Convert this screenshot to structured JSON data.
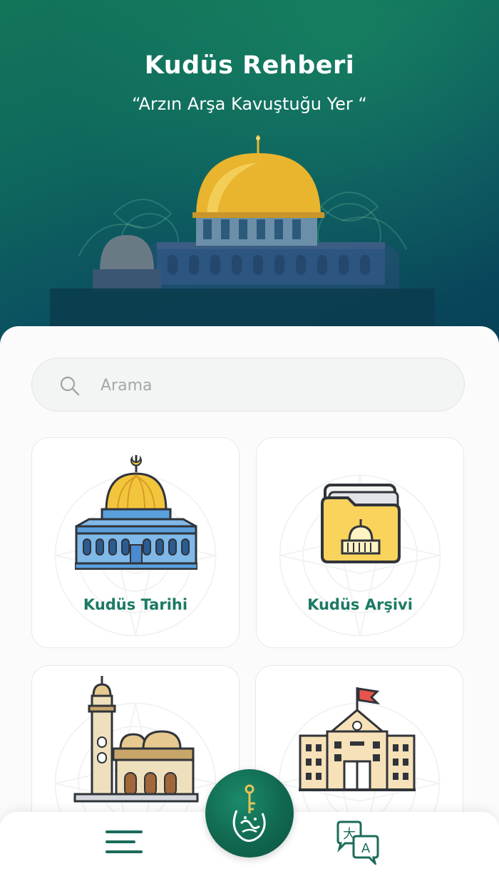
{
  "header": {
    "title": "Kudüs Rehberi",
    "subtitle": "“Arzın Arşa Kavuştuğu Yer “",
    "illustration": "dome-of-the-rock-photo"
  },
  "search": {
    "placeholder": "Arama",
    "value": "",
    "icon": "search-icon"
  },
  "tiles": [
    {
      "label": "Kudüs Tarihi",
      "icon": "dome-of-the-rock-icon"
    },
    {
      "label": "Kudüs Arşivi",
      "icon": "archive-folder-icon"
    },
    {
      "label": "",
      "icon": "minaret-mosque-icon"
    },
    {
      "label": "",
      "icon": "school-building-icon"
    }
  ],
  "bottom_nav": {
    "menu_icon": "hamburger-menu-icon",
    "center_icon": "al-quds-calligraphy-logo",
    "language_icon": "translate-icon"
  },
  "colors": {
    "header_top": "#137559",
    "header_bottom": "#083f57",
    "accent_green": "#1b7a63",
    "dome_gold": "#f2c53d",
    "folder_yellow": "#f9d35c"
  }
}
